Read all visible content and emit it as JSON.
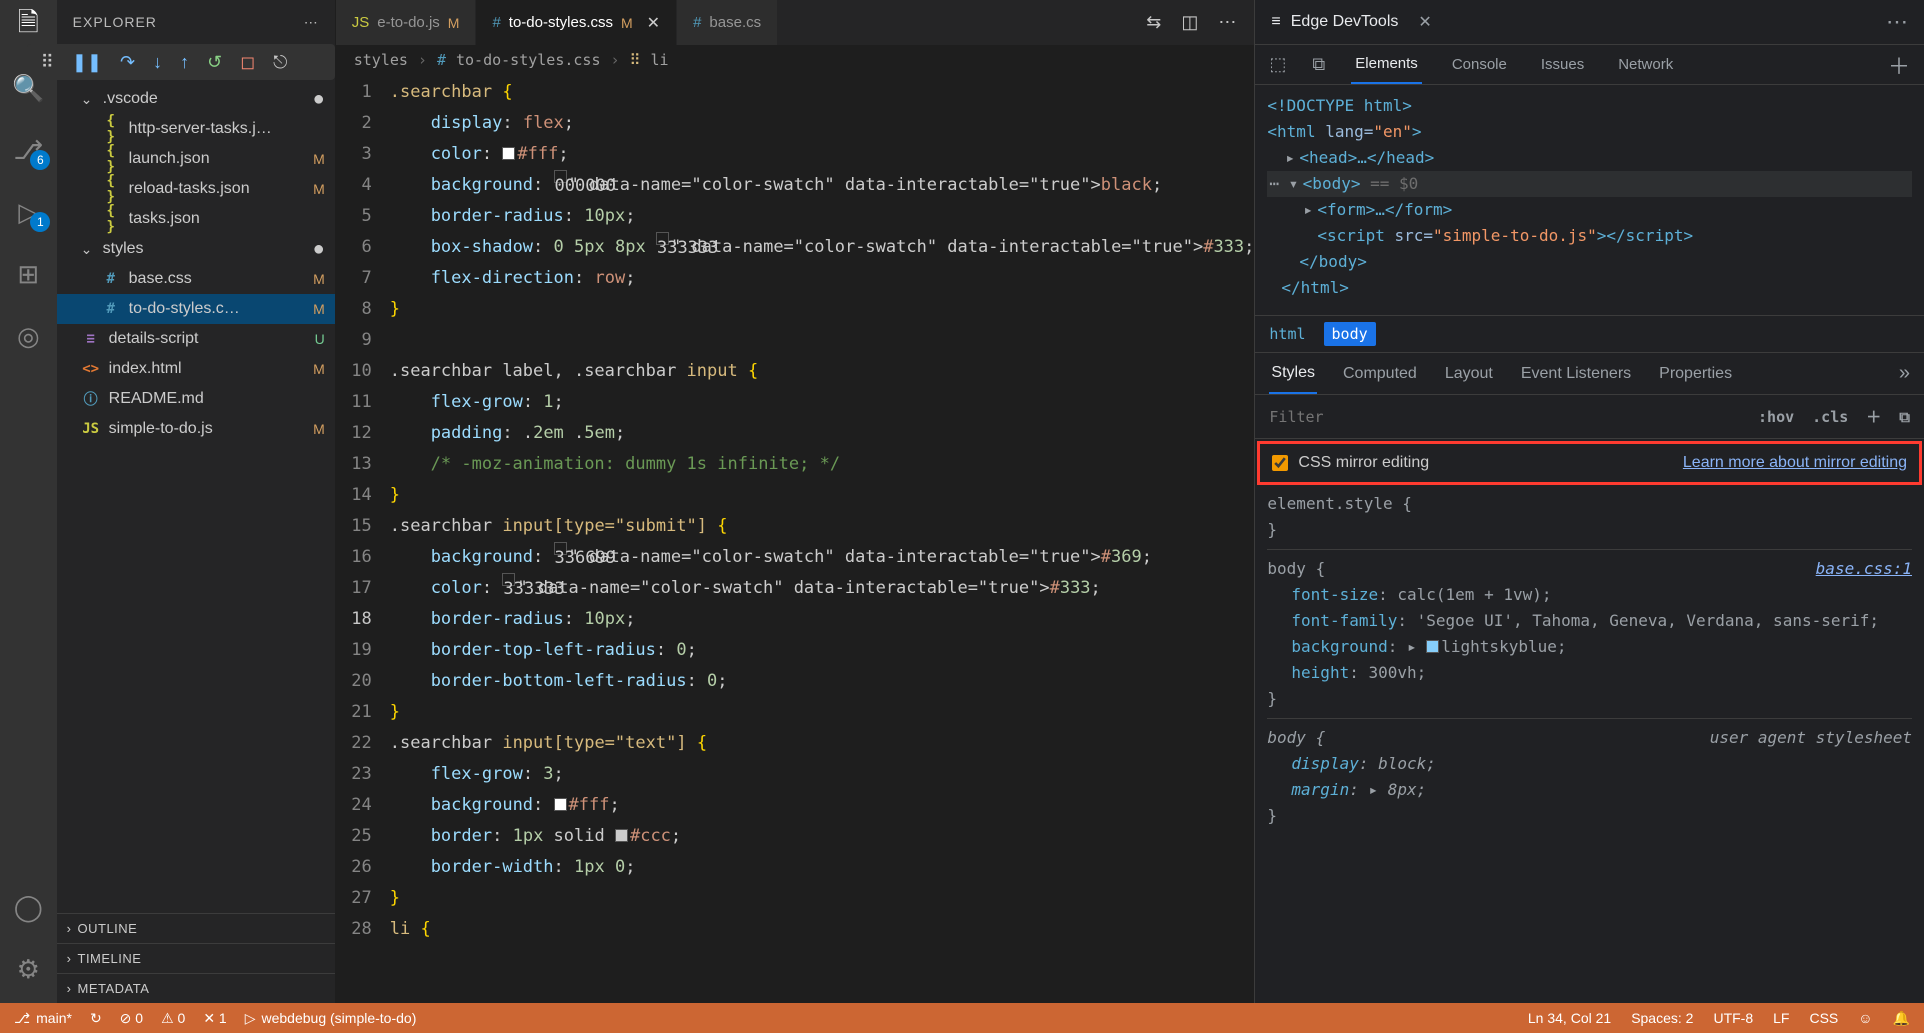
{
  "sidebar": {
    "title": "EXPLORER",
    "badges": {
      "scm": "6",
      "debug": "1"
    },
    "vscode_folder": ".vscode",
    "files": [
      {
        "name": "http-server-tasks.j…",
        "icon": "{ }",
        "iconClass": "json",
        "status": ""
      },
      {
        "name": "launch.json",
        "icon": "{ }",
        "iconClass": "json",
        "status": "M"
      },
      {
        "name": "reload-tasks.json",
        "icon": "{ }",
        "iconClass": "json",
        "status": "M"
      },
      {
        "name": "tasks.json",
        "icon": "{ }",
        "iconClass": "json",
        "status": ""
      }
    ],
    "styles_folder": "styles",
    "styles": [
      {
        "name": "base.css",
        "icon": "#",
        "iconClass": "css",
        "status": "M"
      },
      {
        "name": "to-do-styles.c…",
        "icon": "#",
        "iconClass": "css",
        "status": "M",
        "selected": true
      }
    ],
    "root": [
      {
        "name": "details-script",
        "icon": "≡",
        "iconClass": "img",
        "status": "U",
        "sclass": "u"
      },
      {
        "name": "index.html",
        "icon": "<>",
        "iconClass": "html",
        "status": "M"
      },
      {
        "name": "README.md",
        "icon": "ⓘ",
        "iconClass": "md",
        "status": ""
      },
      {
        "name": "simple-to-do.js",
        "icon": "JS",
        "iconClass": "js",
        "status": "M"
      }
    ],
    "sections": [
      "OUTLINE",
      "TIMELINE",
      "METADATA"
    ]
  },
  "tabs": [
    {
      "label": "e-to-do.js",
      "icon": "JS",
      "iconClass": "js",
      "status": "M"
    },
    {
      "label": "to-do-styles.css",
      "icon": "#",
      "iconClass": "css",
      "status": "M",
      "active": true,
      "close": true
    },
    {
      "label": "base.cs",
      "icon": "#",
      "iconClass": "css"
    }
  ],
  "breadcrumb": {
    "p1": "styles",
    "p2": "to-do-styles.css",
    "p3": "li"
  },
  "code": {
    "lines": [
      ".searchbar {",
      "    display: flex;",
      "    color: ▢#fff;",
      "    background: ▢black;",
      "    border-radius: 10px;",
      "    box-shadow: 0 5px 8px ▢#333;",
      "    flex-direction: row;",
      "}",
      "",
      ".searchbar label, .searchbar input {",
      "    flex-grow: 1;",
      "    padding: .2em .5em;",
      "    /* -moz-animation: dummy 1s infinite; */",
      "}",
      ".searchbar input[type=\"submit\"] {",
      "    background: ▢#369;",
      "    color: ▢#333;",
      "    border-radius: 10px;",
      "    border-top-left-radius: 0;",
      "    border-bottom-left-radius: 0;",
      "}",
      ".searchbar input[type=\"text\"] {",
      "    flex-grow: 3;",
      "    background: ▢#fff;",
      "    border: 1px solid ▢#ccc;",
      "    border-width: 1px 0;",
      "}",
      "li {"
    ],
    "current_line": 18
  },
  "devtools": {
    "title": "Edge DevTools",
    "tabs": [
      "Elements",
      "Console",
      "Issues",
      "Network"
    ],
    "dom": {
      "doctype": "<!DOCTYPE html>",
      "html_open": "<html lang=\"en\">",
      "head": "<head>…</head>",
      "body_open": "<body>",
      "body_hint": "== $0",
      "form": "<form>…</form>",
      "script": "<script src=\"simple-to-do.js\"></",
      "script2": "script>",
      "body_close": "</body>",
      "html_close": "</html>"
    },
    "bc": [
      "html",
      "body"
    ],
    "styletabs": [
      "Styles",
      "Computed",
      "Layout",
      "Event Listeners",
      "Properties"
    ],
    "filter": {
      "placeholder": "Filter",
      "hov": ":hov",
      "cls": ".cls"
    },
    "mirror": {
      "label": "CSS mirror editing",
      "link": "Learn more about mirror editing",
      "checked": true
    },
    "rules": {
      "el": "element.style {",
      "body_sel": "body {",
      "body_src": "base.css:1",
      "font_size": "font-size: calc(1em + 1vw);",
      "font_family": "font-family: 'Segoe UI', Tahoma, Geneva, Verdana, sans-serif;",
      "background": "background: ▶ ▢ lightskyblue;",
      "height": "height: 300vh;",
      "ua_label": "user agent stylesheet",
      "display": "display: block;",
      "margin": "margin: ▶ 8px;"
    }
  },
  "status": {
    "branch": "main*",
    "sync": "↻",
    "errors": "⊘ 0",
    "warnings": "⚠ 0",
    "tools": "✕ 1",
    "debug": "webdebug (simple-to-do)",
    "pos": "Ln 34, Col 21",
    "spaces": "Spaces: 2",
    "encoding": "UTF-8",
    "eol": "LF",
    "lang": "CSS"
  }
}
